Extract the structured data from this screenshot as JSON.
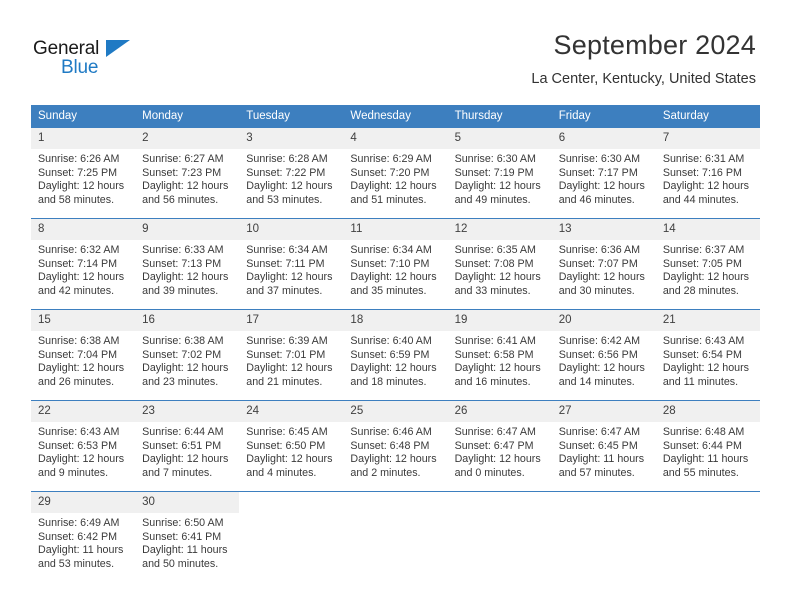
{
  "brand": {
    "name_part1": "General",
    "name_part2": "Blue",
    "accent_color": "#1f7ac4"
  },
  "header": {
    "month_title": "September 2024",
    "location": "La Center, Kentucky, United States"
  },
  "colors": {
    "header_row_bg": "#3d7fbf",
    "day_number_bg": "#f0f0f0",
    "text": "#3a3a3a"
  },
  "weekdays": [
    "Sunday",
    "Monday",
    "Tuesday",
    "Wednesday",
    "Thursday",
    "Friday",
    "Saturday"
  ],
  "labels": {
    "sunrise_prefix": "Sunrise:",
    "sunset_prefix": "Sunset:",
    "daylight_prefix": "Daylight:"
  },
  "weeks": [
    [
      {
        "day": "1",
        "sunrise": "Sunrise: 6:26 AM",
        "sunset": "Sunset: 7:25 PM",
        "daylight1": "Daylight: 12 hours",
        "daylight2": "and 58 minutes."
      },
      {
        "day": "2",
        "sunrise": "Sunrise: 6:27 AM",
        "sunset": "Sunset: 7:23 PM",
        "daylight1": "Daylight: 12 hours",
        "daylight2": "and 56 minutes."
      },
      {
        "day": "3",
        "sunrise": "Sunrise: 6:28 AM",
        "sunset": "Sunset: 7:22 PM",
        "daylight1": "Daylight: 12 hours",
        "daylight2": "and 53 minutes."
      },
      {
        "day": "4",
        "sunrise": "Sunrise: 6:29 AM",
        "sunset": "Sunset: 7:20 PM",
        "daylight1": "Daylight: 12 hours",
        "daylight2": "and 51 minutes."
      },
      {
        "day": "5",
        "sunrise": "Sunrise: 6:30 AM",
        "sunset": "Sunset: 7:19 PM",
        "daylight1": "Daylight: 12 hours",
        "daylight2": "and 49 minutes."
      },
      {
        "day": "6",
        "sunrise": "Sunrise: 6:30 AM",
        "sunset": "Sunset: 7:17 PM",
        "daylight1": "Daylight: 12 hours",
        "daylight2": "and 46 minutes."
      },
      {
        "day": "7",
        "sunrise": "Sunrise: 6:31 AM",
        "sunset": "Sunset: 7:16 PM",
        "daylight1": "Daylight: 12 hours",
        "daylight2": "and 44 minutes."
      }
    ],
    [
      {
        "day": "8",
        "sunrise": "Sunrise: 6:32 AM",
        "sunset": "Sunset: 7:14 PM",
        "daylight1": "Daylight: 12 hours",
        "daylight2": "and 42 minutes."
      },
      {
        "day": "9",
        "sunrise": "Sunrise: 6:33 AM",
        "sunset": "Sunset: 7:13 PM",
        "daylight1": "Daylight: 12 hours",
        "daylight2": "and 39 minutes."
      },
      {
        "day": "10",
        "sunrise": "Sunrise: 6:34 AM",
        "sunset": "Sunset: 7:11 PM",
        "daylight1": "Daylight: 12 hours",
        "daylight2": "and 37 minutes."
      },
      {
        "day": "11",
        "sunrise": "Sunrise: 6:34 AM",
        "sunset": "Sunset: 7:10 PM",
        "daylight1": "Daylight: 12 hours",
        "daylight2": "and 35 minutes."
      },
      {
        "day": "12",
        "sunrise": "Sunrise: 6:35 AM",
        "sunset": "Sunset: 7:08 PM",
        "daylight1": "Daylight: 12 hours",
        "daylight2": "and 33 minutes."
      },
      {
        "day": "13",
        "sunrise": "Sunrise: 6:36 AM",
        "sunset": "Sunset: 7:07 PM",
        "daylight1": "Daylight: 12 hours",
        "daylight2": "and 30 minutes."
      },
      {
        "day": "14",
        "sunrise": "Sunrise: 6:37 AM",
        "sunset": "Sunset: 7:05 PM",
        "daylight1": "Daylight: 12 hours",
        "daylight2": "and 28 minutes."
      }
    ],
    [
      {
        "day": "15",
        "sunrise": "Sunrise: 6:38 AM",
        "sunset": "Sunset: 7:04 PM",
        "daylight1": "Daylight: 12 hours",
        "daylight2": "and 26 minutes."
      },
      {
        "day": "16",
        "sunrise": "Sunrise: 6:38 AM",
        "sunset": "Sunset: 7:02 PM",
        "daylight1": "Daylight: 12 hours",
        "daylight2": "and 23 minutes."
      },
      {
        "day": "17",
        "sunrise": "Sunrise: 6:39 AM",
        "sunset": "Sunset: 7:01 PM",
        "daylight1": "Daylight: 12 hours",
        "daylight2": "and 21 minutes."
      },
      {
        "day": "18",
        "sunrise": "Sunrise: 6:40 AM",
        "sunset": "Sunset: 6:59 PM",
        "daylight1": "Daylight: 12 hours",
        "daylight2": "and 18 minutes."
      },
      {
        "day": "19",
        "sunrise": "Sunrise: 6:41 AM",
        "sunset": "Sunset: 6:58 PM",
        "daylight1": "Daylight: 12 hours",
        "daylight2": "and 16 minutes."
      },
      {
        "day": "20",
        "sunrise": "Sunrise: 6:42 AM",
        "sunset": "Sunset: 6:56 PM",
        "daylight1": "Daylight: 12 hours",
        "daylight2": "and 14 minutes."
      },
      {
        "day": "21",
        "sunrise": "Sunrise: 6:43 AM",
        "sunset": "Sunset: 6:54 PM",
        "daylight1": "Daylight: 12 hours",
        "daylight2": "and 11 minutes."
      }
    ],
    [
      {
        "day": "22",
        "sunrise": "Sunrise: 6:43 AM",
        "sunset": "Sunset: 6:53 PM",
        "daylight1": "Daylight: 12 hours",
        "daylight2": "and 9 minutes."
      },
      {
        "day": "23",
        "sunrise": "Sunrise: 6:44 AM",
        "sunset": "Sunset: 6:51 PM",
        "daylight1": "Daylight: 12 hours",
        "daylight2": "and 7 minutes."
      },
      {
        "day": "24",
        "sunrise": "Sunrise: 6:45 AM",
        "sunset": "Sunset: 6:50 PM",
        "daylight1": "Daylight: 12 hours",
        "daylight2": "and 4 minutes."
      },
      {
        "day": "25",
        "sunrise": "Sunrise: 6:46 AM",
        "sunset": "Sunset: 6:48 PM",
        "daylight1": "Daylight: 12 hours",
        "daylight2": "and 2 minutes."
      },
      {
        "day": "26",
        "sunrise": "Sunrise: 6:47 AM",
        "sunset": "Sunset: 6:47 PM",
        "daylight1": "Daylight: 12 hours",
        "daylight2": "and 0 minutes."
      },
      {
        "day": "27",
        "sunrise": "Sunrise: 6:47 AM",
        "sunset": "Sunset: 6:45 PM",
        "daylight1": "Daylight: 11 hours",
        "daylight2": "and 57 minutes."
      },
      {
        "day": "28",
        "sunrise": "Sunrise: 6:48 AM",
        "sunset": "Sunset: 6:44 PM",
        "daylight1": "Daylight: 11 hours",
        "daylight2": "and 55 minutes."
      }
    ],
    [
      {
        "day": "29",
        "sunrise": "Sunrise: 6:49 AM",
        "sunset": "Sunset: 6:42 PM",
        "daylight1": "Daylight: 11 hours",
        "daylight2": "and 53 minutes."
      },
      {
        "day": "30",
        "sunrise": "Sunrise: 6:50 AM",
        "sunset": "Sunset: 6:41 PM",
        "daylight1": "Daylight: 11 hours",
        "daylight2": "and 50 minutes."
      },
      {
        "day": "",
        "sunrise": "",
        "sunset": "",
        "daylight1": "",
        "daylight2": ""
      },
      {
        "day": "",
        "sunrise": "",
        "sunset": "",
        "daylight1": "",
        "daylight2": ""
      },
      {
        "day": "",
        "sunrise": "",
        "sunset": "",
        "daylight1": "",
        "daylight2": ""
      },
      {
        "day": "",
        "sunrise": "",
        "sunset": "",
        "daylight1": "",
        "daylight2": ""
      },
      {
        "day": "",
        "sunrise": "",
        "sunset": "",
        "daylight1": "",
        "daylight2": ""
      }
    ]
  ]
}
